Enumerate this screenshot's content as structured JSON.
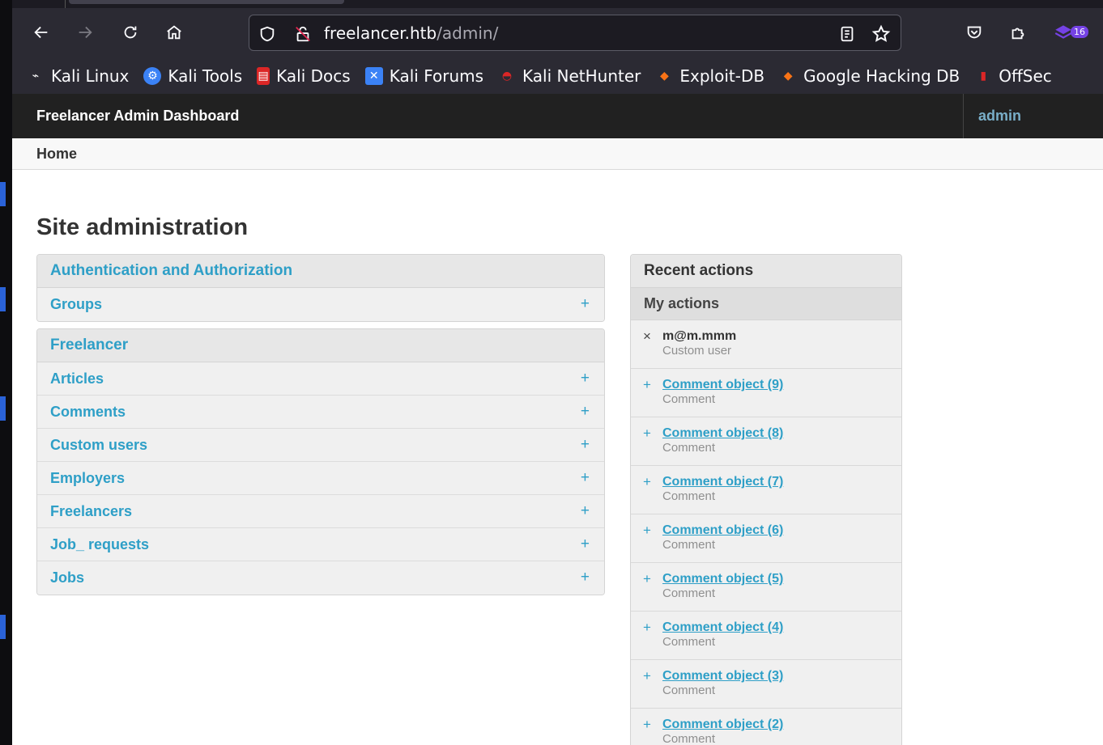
{
  "browser": {
    "url_host": "freelancer.htb",
    "url_path": "/admin/",
    "extension_badge": "16",
    "bookmarks": [
      {
        "label": "Kali Linux",
        "icon": "kali-dragon-icon",
        "color": "#ffffff"
      },
      {
        "label": "Kali Tools",
        "icon": "kali-tools-icon",
        "color": "#3b82f6"
      },
      {
        "label": "Kali Docs",
        "icon": "kali-docs-icon",
        "color": "#dc2626"
      },
      {
        "label": "Kali Forums",
        "icon": "kali-forums-icon",
        "color": "#3b82f6"
      },
      {
        "label": "Kali NetHunter",
        "icon": "kali-nethunter-icon",
        "color": "#dc2626"
      },
      {
        "label": "Exploit-DB",
        "icon": "exploit-db-icon",
        "color": "#f97316"
      },
      {
        "label": "Google Hacking DB",
        "icon": "ghdb-icon",
        "color": "#f97316"
      },
      {
        "label": "OffSec",
        "icon": "offsec-icon",
        "color": "#dc2626"
      }
    ]
  },
  "header": {
    "brand": "Freelancer Admin Dashboard",
    "user": "admin"
  },
  "breadcrumb": {
    "home": "Home"
  },
  "main": {
    "title": "Site administration",
    "apps": [
      {
        "name": "Authentication and Authorization",
        "models": [
          {
            "name": "Groups",
            "add": "+"
          }
        ]
      },
      {
        "name": "Freelancer",
        "models": [
          {
            "name": "Articles",
            "add": "+"
          },
          {
            "name": "Comments",
            "add": "+"
          },
          {
            "name": "Custom users",
            "add": "+"
          },
          {
            "name": "Employers",
            "add": "+"
          },
          {
            "name": "Freelancers",
            "add": "+"
          },
          {
            "name": "Job_ requests",
            "add": "+"
          },
          {
            "name": "Jobs",
            "add": "+"
          }
        ]
      }
    ]
  },
  "recent": {
    "title": "Recent actions",
    "subtitle": "My actions",
    "items": [
      {
        "symbol": "×",
        "name": "m@m.mmm",
        "type": "Custom user",
        "deleted": true
      },
      {
        "symbol": "+",
        "name": "Comment object (9)",
        "type": "Comment",
        "deleted": false
      },
      {
        "symbol": "+",
        "name": "Comment object (8)",
        "type": "Comment",
        "deleted": false
      },
      {
        "symbol": "+",
        "name": "Comment object (7)",
        "type": "Comment",
        "deleted": false
      },
      {
        "symbol": "+",
        "name": "Comment object (6)",
        "type": "Comment",
        "deleted": false
      },
      {
        "symbol": "+",
        "name": "Comment object (5)",
        "type": "Comment",
        "deleted": false
      },
      {
        "symbol": "+",
        "name": "Comment object (4)",
        "type": "Comment",
        "deleted": false
      },
      {
        "symbol": "+",
        "name": "Comment object (3)",
        "type": "Comment",
        "deleted": false
      },
      {
        "symbol": "+",
        "name": "Comment object (2)",
        "type": "Comment",
        "deleted": false
      }
    ]
  }
}
